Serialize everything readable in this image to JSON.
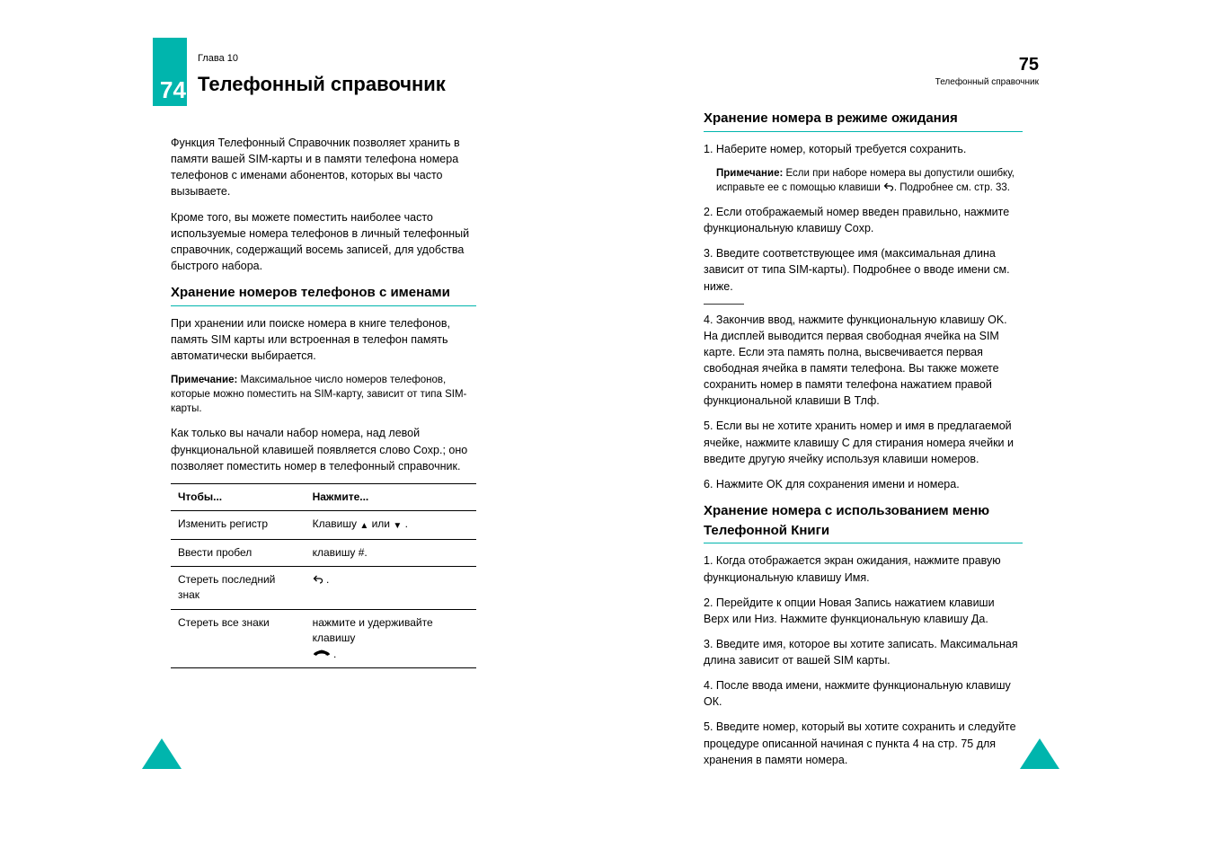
{
  "leftPage": {
    "pageNumber": "74",
    "chapterLabel": "Глава 10",
    "chapterTitle": "Телефонный справочник",
    "intro1": "Функция Телефонный Cправочник позволяет хранить в памяти вашей SIM-карты и в памяти телефона номера телефонов с именами абонентов, которых вы часто вызываете.",
    "intro2": "Кроме того, вы можете поместить наиболее часто используемые номера телефонов в личный телефонный справочник, содержащий восемь записей, для удобства быстрого набора.",
    "h2": "Хранение номеров телефонов с именами",
    "p3": "При хранении или поиске номера в книге телефонов, память SIM карты или встроенная в телефон память автоматически выбирается.",
    "noteTitle": "Примечание:",
    "noteBody": " Максимальное число номеров телефонов, которые можно поместить на SIM-карту, зависит от типа SIM-карты.",
    "p4": "Как только вы начали набор номера, над левой функциональной клавишей появляется слово Coxp.; оно позволяет поместить номер в телефонный справочник.",
    "table": {
      "headers": [
        "Чтобы...",
        "Нажмите..."
      ],
      "rows": [
        {
          "c1": "Изменить регистр",
          "c2_pre": "Клавишу ",
          "c2_icons": "arrows",
          "c2_mid": " или ",
          "c2_post": " ."
        },
        {
          "c1": "Bвести пробел",
          "c2": "клавишу #."
        },
        {
          "c1": "Стереть последний знак",
          "c2_icon": "back",
          "c2_post": " ."
        },
        {
          "c1": "Стереть все знаки",
          "c2_icon": "phone",
          "c2_pre": "нажмите и удерживайте клавишу ",
          "c2_post": " ."
        }
      ]
    }
  },
  "rightPage": {
    "pageNumber": "75",
    "chapterLabel": "Телефонный справочник",
    "h2a": "Хранение номера в режиме ожидания",
    "step1": {
      "num": "1.",
      "text": "Наберите номер, который требуется сохранить."
    },
    "noteTitle": "Примечание:",
    "noteBody_a": " Если при наборе номера вы допустили ошибку, исправьте ее с помощью клавиши ",
    "noteBody_b": ". Подробнее cм. cтр. 33.",
    "step2": {
      "num": "2.",
      "text": "Если отображаемый номер введен правильно, нажмите функциональную клавишу Coxp."
    },
    "step3": {
      "num": "3.",
      "text": "Введите соответствующее имя (максимальная длина зависит от типа SIM-карты). Подробнее о вводе имени см. ниже."
    },
    "step4": {
      "num": "4.",
      "text": "Закончив ввод, нажмите функциональную клавишу OK. На дисплей выводится первая свободная ячейка на SIM карте. Если эта память полна, высвечивается первая свободная ячейка в памяти телефона. Вы также можете сохранить номер в памяти телефона нажатиeм правой функциональной клавиши В Тлф."
    },
    "step5": {
      "num": "5.",
      "text": "Если вы не хотите хранить номер и имя в предлагаемой ячейке, нажмите клавишу С для стирания номера ячейки и введите другую ячейку используя клавиши номеров."
    },
    "step6": {
      "num": "6.",
      "text": "Нажмите OK для сохранения имени и номера."
    },
    "h2b": "Хранение номера с использованием меню Телефонной Книги",
    "b_step1": {
      "num": "1.",
      "text": "Когда отображается экран ожидания, нажмите правую функциональную клавишу Имя."
    },
    "b_step2": {
      "num": "2.",
      "text": "Перейдите к опции Новая Запись нажатием клавиши Верх или Низ. Нажмите функциональную клавишу Да."
    },
    "b_step3": {
      "num": "3.",
      "text": "Введите имя, которое вы хотите записать. Максимальная длина зависит от вашей SIM карты."
    },
    "b_step4": {
      "num": "4.",
      "text": "После ввода имени, нажмите функциональную клавишу ОК."
    },
    "b_step5": {
      "num": "5.",
      "text": "Введите номер, который вы хотите сохранить и следуйте процедуре описанной начиная с пункта 4 на стр. 75 для хранения в памяти номера."
    }
  }
}
